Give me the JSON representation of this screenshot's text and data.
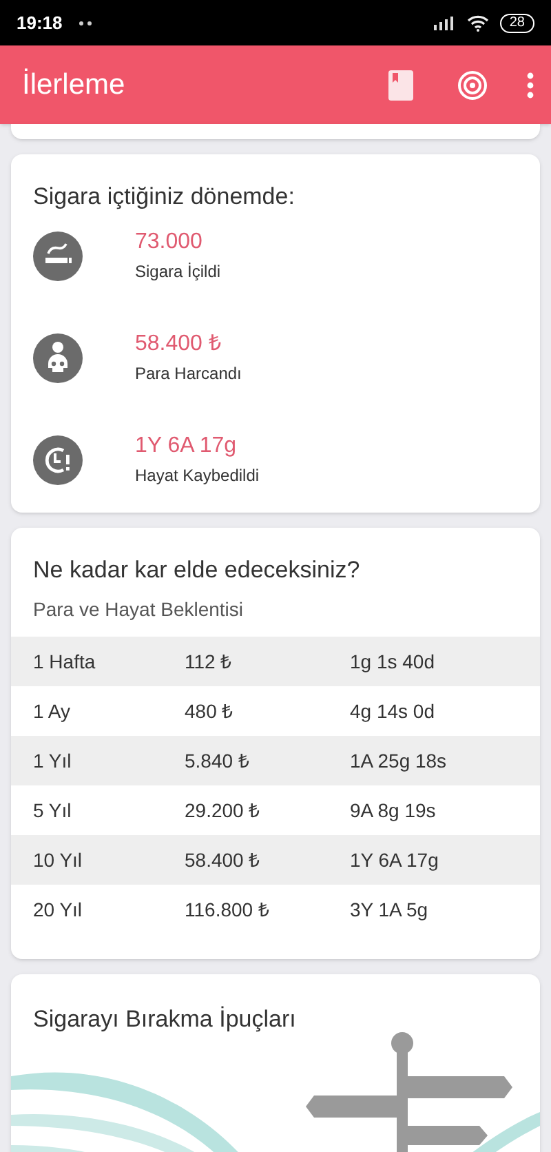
{
  "status_bar": {
    "time": "19:18",
    "battery": "28"
  },
  "app_bar": {
    "title": "İlerleme"
  },
  "smoking_card": {
    "title": "Sigara içtiğiniz dönemde:",
    "stats": [
      {
        "kind": "cigarette",
        "value": "73.000",
        "label": "Sigara İçildi"
      },
      {
        "kind": "money",
        "value": "58.400 ₺",
        "label": "Para Harcandı"
      },
      {
        "kind": "time",
        "value": "1Y 6A 17g",
        "label": "Hayat Kaybedildi"
      }
    ]
  },
  "gain_card": {
    "title": "Ne kadar kar elde edeceksiniz?",
    "subtitle": "Para ve Hayat Beklentisi",
    "rows": [
      {
        "period": "1 Hafta",
        "money": "112 ₺",
        "life": "1g 1s 40d",
        "shaded": true
      },
      {
        "period": "1 Ay",
        "money": "480 ₺",
        "life": "4g 14s 0d",
        "shaded": false
      },
      {
        "period": "1 Yıl",
        "money": "5.840 ₺",
        "life": "1A 25g 18s",
        "shaded": true
      },
      {
        "period": "5 Yıl",
        "money": "29.200 ₺",
        "life": "9A 8g 19s",
        "shaded": false
      },
      {
        "period": "10 Yıl",
        "money": "58.400 ₺",
        "life": "1Y 6A 17g",
        "shaded": true
      },
      {
        "period": "20 Yıl",
        "money": "116.800 ₺",
        "life": "3Y 1A 5g",
        "shaded": false
      }
    ]
  },
  "tips_card": {
    "title": "Sigarayı Bırakma İpuçları"
  }
}
